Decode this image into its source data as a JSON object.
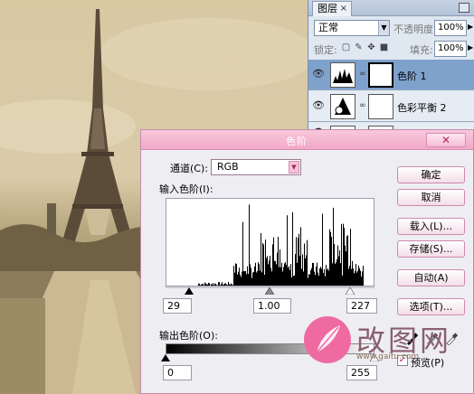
{
  "layers_panel": {
    "tab_label": "图层",
    "tab_close": "×",
    "blend_mode": "正常",
    "opacity_label": "不透明度:",
    "opacity_value": "100%",
    "lock_label": "锁定:",
    "fill_label": "填充:",
    "fill_value": "100%",
    "layers": [
      {
        "name": "色阶 1",
        "selected": true,
        "icon": "levels-adjustment-icon"
      },
      {
        "name": "色彩平衡 2",
        "selected": false,
        "icon": "color-balance-adjustment-icon"
      }
    ]
  },
  "dialog": {
    "title": "色阶",
    "close_glyph": "✕",
    "channel_label": "通道(C):",
    "channel_value": "RGB",
    "input_levels_label": "输入色阶(I):",
    "input_black": "29",
    "input_gamma": "1.00",
    "input_white": "227",
    "output_levels_label": "输出色阶(O):",
    "output_black": "0",
    "output_white": "255",
    "buttons": {
      "ok": "确定",
      "cancel": "取消",
      "load": "载入(L)...",
      "save": "存储(S)...",
      "auto": "自动(A)",
      "options": "选项(T)..."
    },
    "preview_label": "预览(P)",
    "preview_checked": true
  },
  "watermark": {
    "text": "改图网",
    "url": "www.gaitu.com"
  },
  "colors": {
    "dialog_accent": "#f2a8c6",
    "selected_layer": "#7fa2cd"
  }
}
